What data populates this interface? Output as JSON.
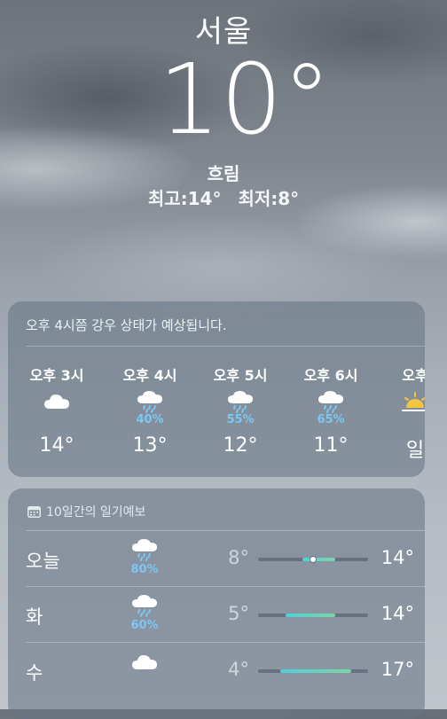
{
  "location": {
    "city": "서울",
    "current_temp": "10°",
    "condition": "흐림",
    "high": "최고:14°",
    "low": "최저:8°"
  },
  "hourly": {
    "summary": "오후 4시쯤 강우 상태가 예상됩니다.",
    "items": [
      {
        "time": "오후 3시",
        "icon": "cloud-icon",
        "pop": "",
        "temp": "14°"
      },
      {
        "time": "오후 4시",
        "icon": "cloud-rain-icon",
        "pop": "40%",
        "temp": "13°"
      },
      {
        "time": "오후 5시",
        "icon": "cloud-rain-icon",
        "pop": "55%",
        "temp": "12°"
      },
      {
        "time": "오후 6시",
        "icon": "cloud-rain-icon",
        "pop": "65%",
        "temp": "11°"
      },
      {
        "time": "오후",
        "icon": "sunset-icon",
        "pop": "",
        "temp": "일"
      }
    ]
  },
  "daily": {
    "header": "10일간의 일기예보",
    "header_icon": "calendar-icon",
    "items": [
      {
        "day": "오늘",
        "icon": "cloud-rain-icon",
        "pop": "80%",
        "low": "8°",
        "high": "14°",
        "range": [
          8,
          14
        ],
        "current": 10
      },
      {
        "day": "화",
        "icon": "cloud-rain-icon",
        "pop": "60%",
        "low": "5°",
        "high": "14°",
        "range": [
          5,
          14
        ]
      },
      {
        "day": "수",
        "icon": "cloud-icon",
        "pop": "",
        "low": "4°",
        "high": "17°",
        "range": [
          4,
          17
        ]
      }
    ],
    "scale_min": 0,
    "scale_max": 20
  },
  "colors": {
    "precip": "#7cc7f5",
    "bar_start": "#4fd1d9",
    "bar_end": "#7ad6a6"
  }
}
